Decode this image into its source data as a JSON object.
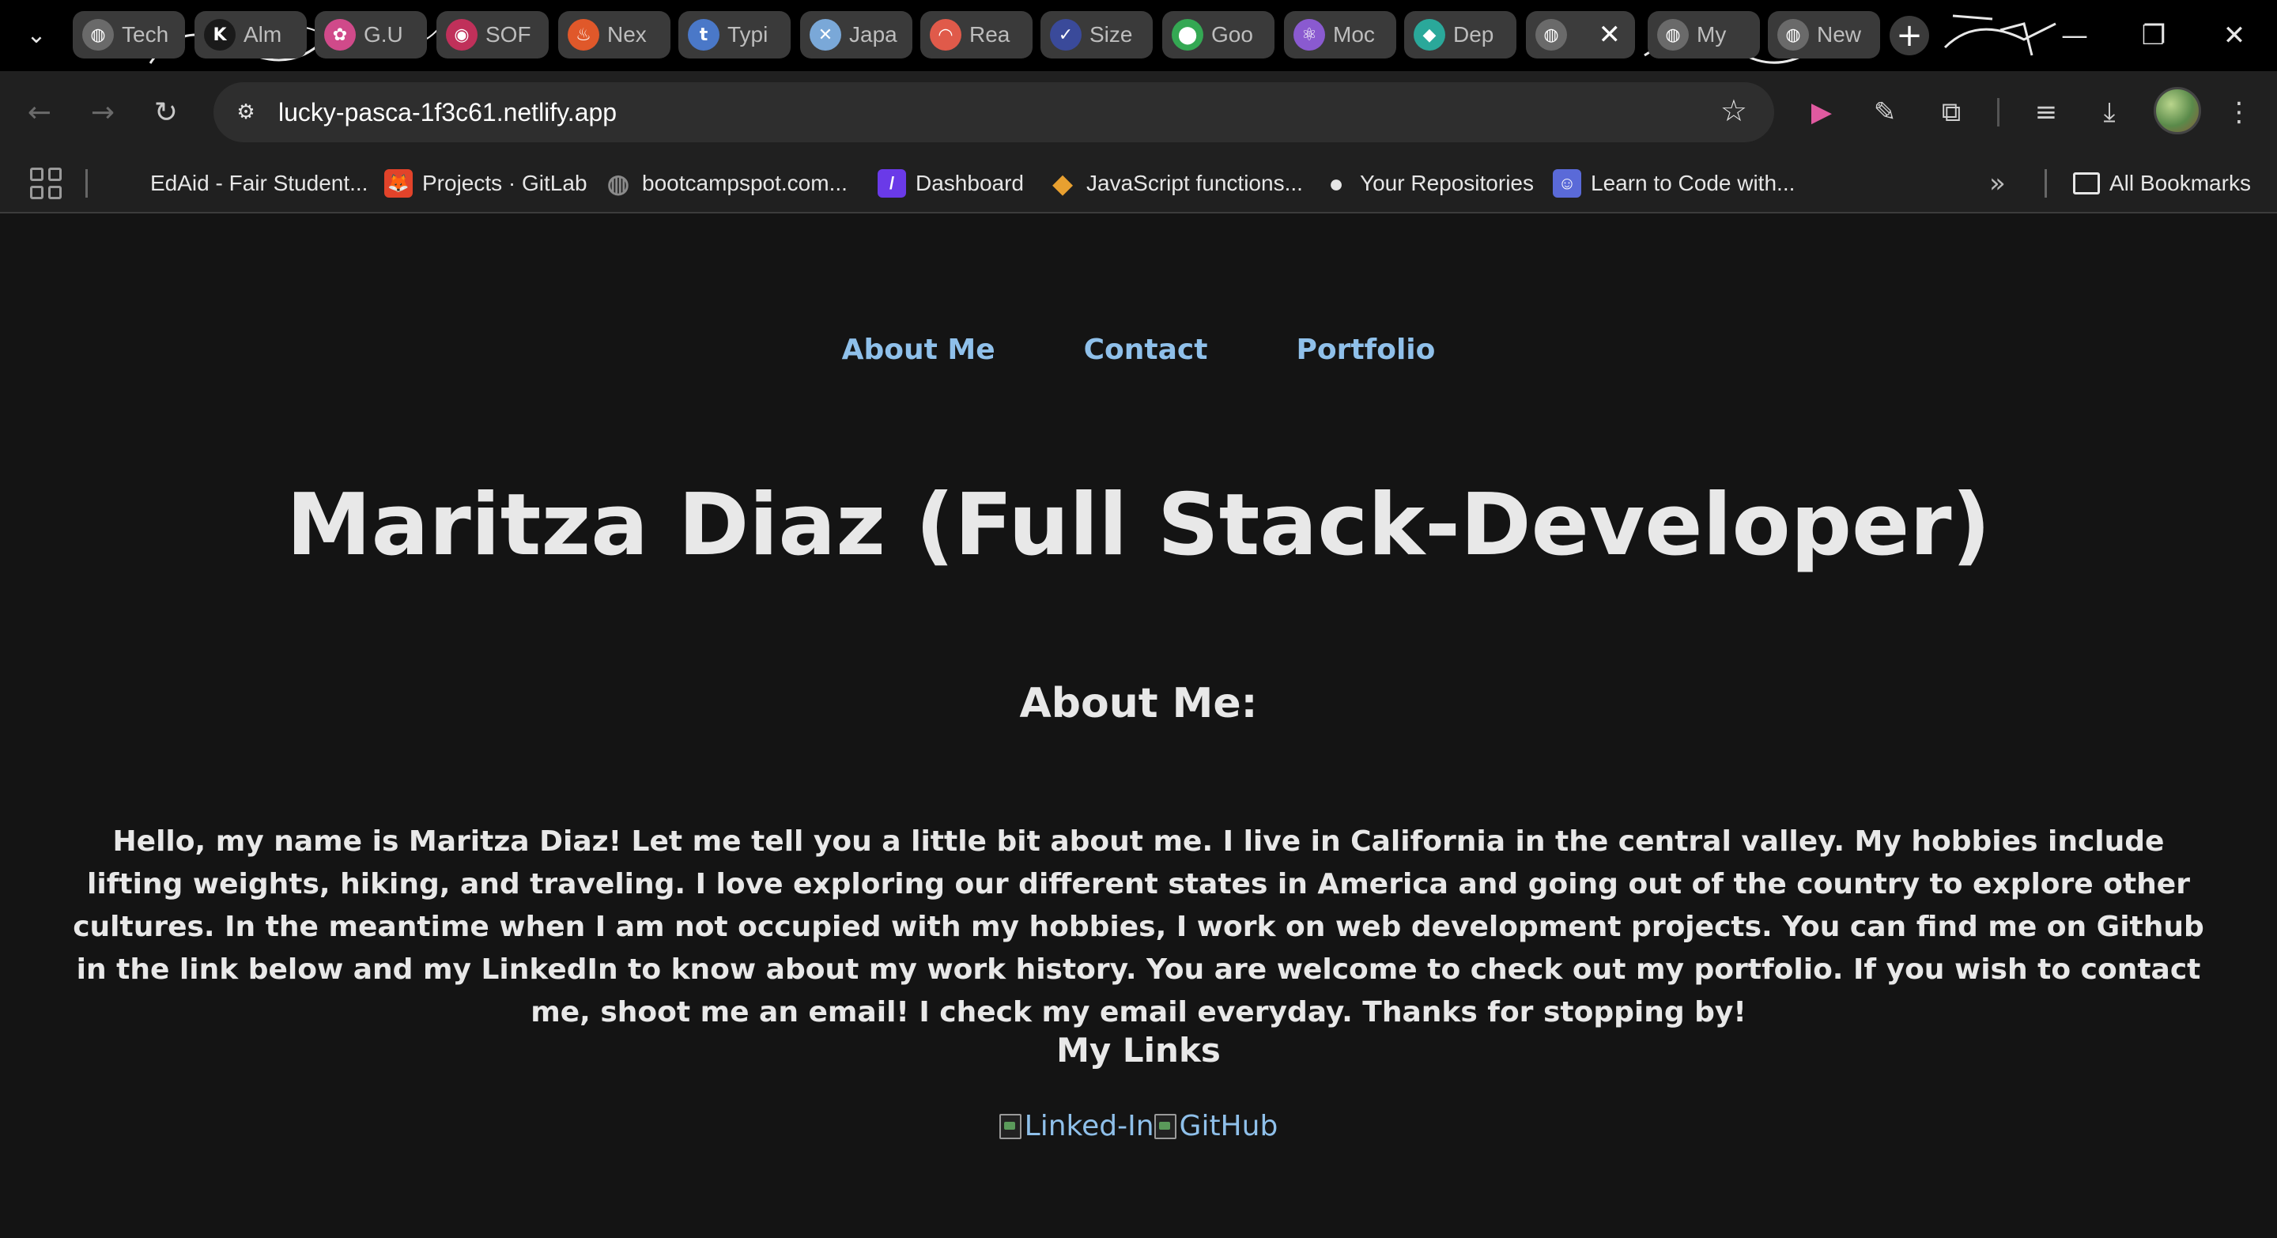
{
  "browser": {
    "tabs": [
      {
        "title": "Tech",
        "icon": "globe-icon",
        "color": "#6a6a6a"
      },
      {
        "title": "Alm",
        "icon": "k-logo-icon",
        "color": "#1a1a1a"
      },
      {
        "title": "G.U",
        "icon": "brain-icon",
        "color": "#d04a8a"
      },
      {
        "title": "SOF",
        "icon": "pink-circle-icon",
        "color": "#c0305a"
      },
      {
        "title": "Nex",
        "icon": "flame-icon",
        "color": "#e0582a"
      },
      {
        "title": "Typi",
        "icon": "t-logo-icon",
        "color": "#4a78c8"
      },
      {
        "title": "Japa",
        "icon": "x-logo-icon",
        "color": "#7aa8d8"
      },
      {
        "title": "Rea",
        "icon": "rainbow-icon",
        "color": "#e05a4a"
      },
      {
        "title": "Size",
        "icon": "check-logo-icon",
        "color": "#3a4a9a"
      },
      {
        "title": "Goo",
        "icon": "maps-pin-icon",
        "color": "#34a853"
      },
      {
        "title": "Moc",
        "icon": "react-icon",
        "color": "#8a5ad0"
      },
      {
        "title": "Dep",
        "icon": "netlify-icon",
        "color": "#2aa89a"
      },
      {
        "title": "",
        "icon": "globe-icon",
        "color": "#6a6a6a",
        "active": true
      },
      {
        "title": "My",
        "icon": "globe-icon",
        "color": "#6a6a6a"
      },
      {
        "title": "New",
        "icon": "globe-icon",
        "color": "#6a6a6a"
      }
    ],
    "url": "lucky-pasca-1f3c61.netlify.app",
    "bookmarks": [
      {
        "label": "EdAid - Fair Student...",
        "icon": "",
        "color": ""
      },
      {
        "label": "Projects · GitLab",
        "icon": "gitlab-icon",
        "color": "#e2432a"
      },
      {
        "label": "bootcampspot.com...",
        "icon": "globe-icon",
        "color": "#8a8a8a"
      },
      {
        "label": "Dashboard",
        "icon": "dashboard-logo-icon",
        "color": "#6a3ae8"
      },
      {
        "label": "JavaScript functions...",
        "icon": "diamond-icon",
        "color": "#e8a030"
      },
      {
        "label": "Your Repositories",
        "icon": "github-icon",
        "color": "#e6e6e6"
      },
      {
        "label": "Learn to Code with...",
        "icon": "robot-icon",
        "color": "#5a6ad8"
      }
    ],
    "all_bookmarks_label": "All Bookmarks"
  },
  "site": {
    "nav": [
      "About Me",
      "Contact",
      "Portfolio"
    ],
    "title": "Maritza Diaz (Full Stack-Developer)",
    "about_heading": "About Me:",
    "about_text": "Hello, my name is Maritza Diaz! Let me tell you a little bit about me. I live in California in the central valley. My hobbies include lifting weights, hiking, and traveling. I love exploring our different states in America and going out of the country to explore other cultures. In the meantime when I am not occupied with my hobbies, I work on web development projects. You can find me on Github in the link below and my LinkedIn to know about my work history. You are welcome to check out my portfolio. If you wish to contact me, shoot me an email! I check my email everyday. Thanks for stopping by!",
    "links_heading": "My Links",
    "links": [
      {
        "alt": "Linked-In"
      },
      {
        "alt": "GitHub"
      }
    ],
    "link_color": "#8fc0ea"
  }
}
